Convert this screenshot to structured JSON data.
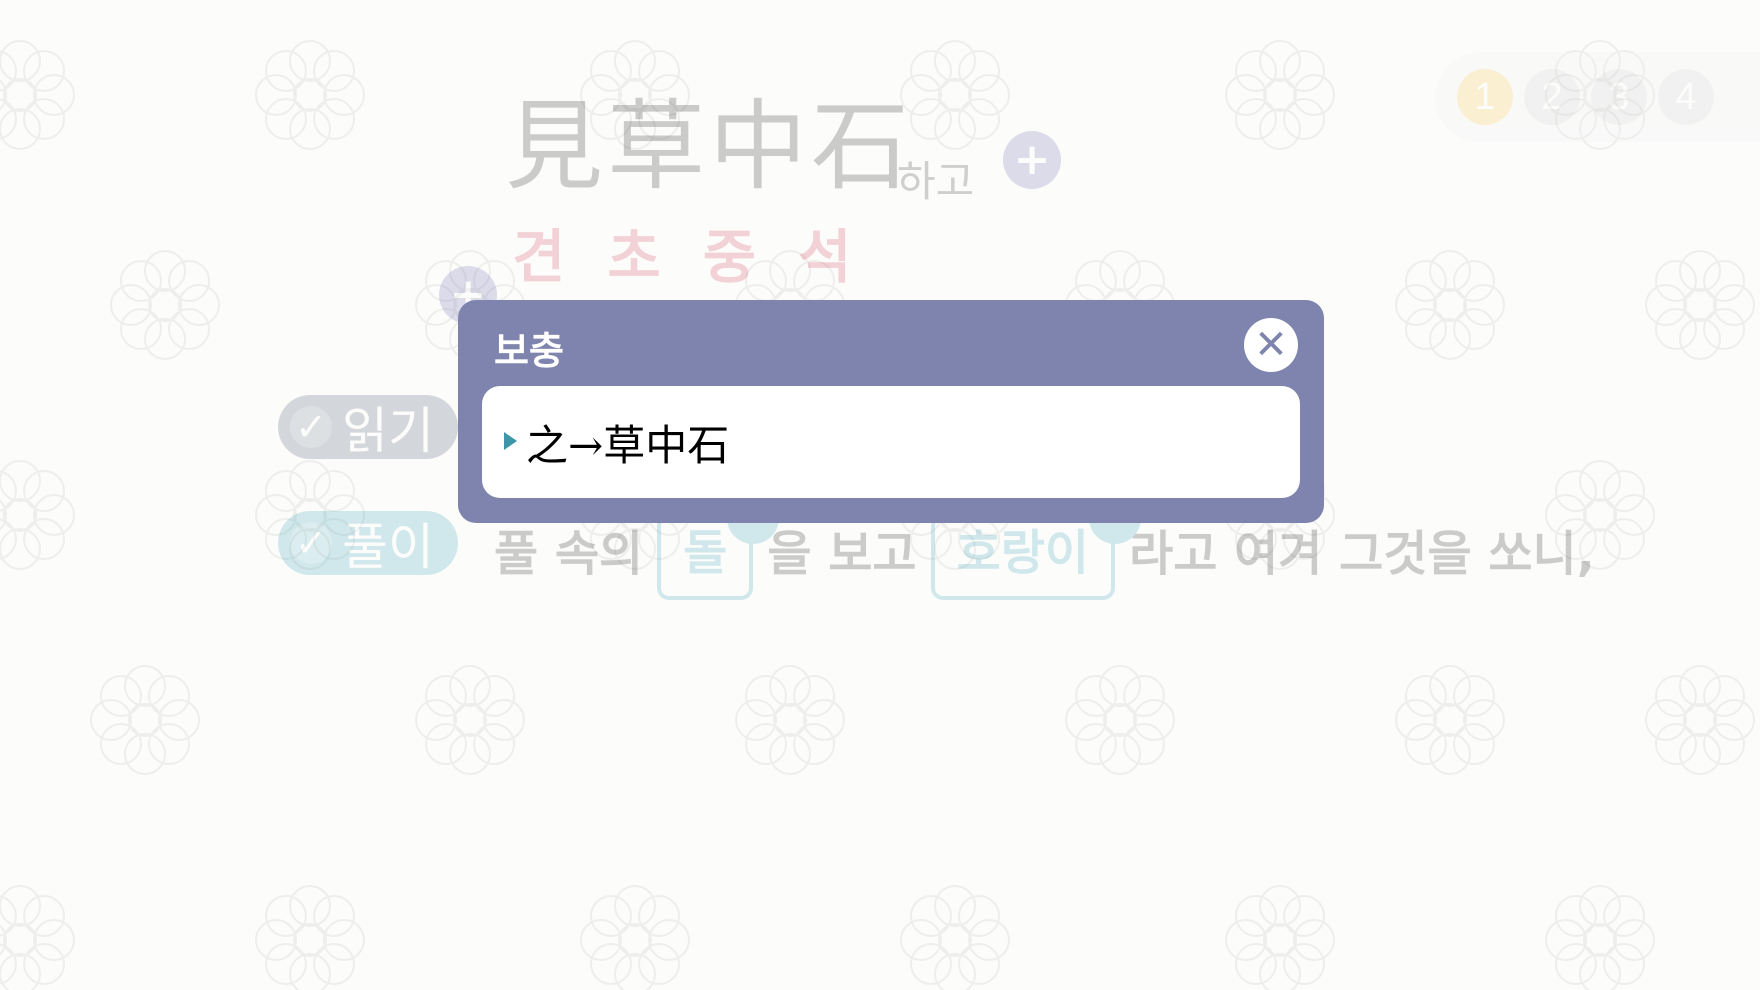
{
  "pagination": {
    "pages": [
      "1",
      "2",
      "3",
      "4"
    ],
    "active": "1"
  },
  "phrase": {
    "hanja": "見草中石",
    "suffix": "하고",
    "reading": "견초중석"
  },
  "buttons": {
    "read_label": "읽기",
    "explain_label": "풀이"
  },
  "sentence": {
    "part1": "풀 속의",
    "blank1": "돌",
    "part2": "을 보고",
    "blank2": "호랑이",
    "part3": "라고 여겨 그것을 쏘니,"
  },
  "modal": {
    "title": "보충",
    "text": "之→草中石"
  },
  "colors": {
    "modal_header": "#7e84ae",
    "accent_teal": "#3aa3b8",
    "reading_red": "#d23b5a",
    "active_page": "#f5c542"
  }
}
